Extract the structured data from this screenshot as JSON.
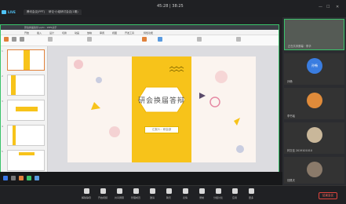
{
  "topbar": {
    "timer": "45:28 | 38:25",
    "live_label": "LIVE",
    "tabs": [
      "腾讯会议(PPT)",
      "研论·小组研讨会议(1期)"
    ]
  },
  "ppt": {
    "window_title": "研会换届答辩.pptx - WPS演示",
    "menu_tabs": [
      "开始",
      "插入",
      "设计",
      "切换",
      "动画",
      "放映",
      "审阅",
      "视图",
      "开发工具",
      "特色功能"
    ],
    "slide_numbers": [
      "1",
      "2",
      "3",
      "4",
      "5"
    ],
    "status_left": "幻灯片 1/5",
    "status_right": "100%"
  },
  "slide": {
    "title": "研会换届答辩",
    "subtitle": "汇报人：研会部"
  },
  "participants": [
    {
      "label": "正在共享屏幕 · 李华",
      "color": "#555b55"
    },
    {
      "label": "孙畅",
      "avatar": "孙畅",
      "color": "#3a7de0"
    },
    {
      "label": "李书瑶",
      "color": "#e08b3a"
    },
    {
      "label": "林文佳 2019101010",
      "color": "#c9b79a"
    },
    {
      "label": "钱昊天",
      "color": "#8a7a6a"
    }
  ],
  "toolbar": {
    "buttons": [
      "解除静音",
      "开启视频",
      "共享屏幕",
      "管理成员",
      "邀请",
      "聊天",
      "表情",
      "录制",
      "分组讨论",
      "应用",
      "更多"
    ],
    "end_label": "结束会议"
  }
}
